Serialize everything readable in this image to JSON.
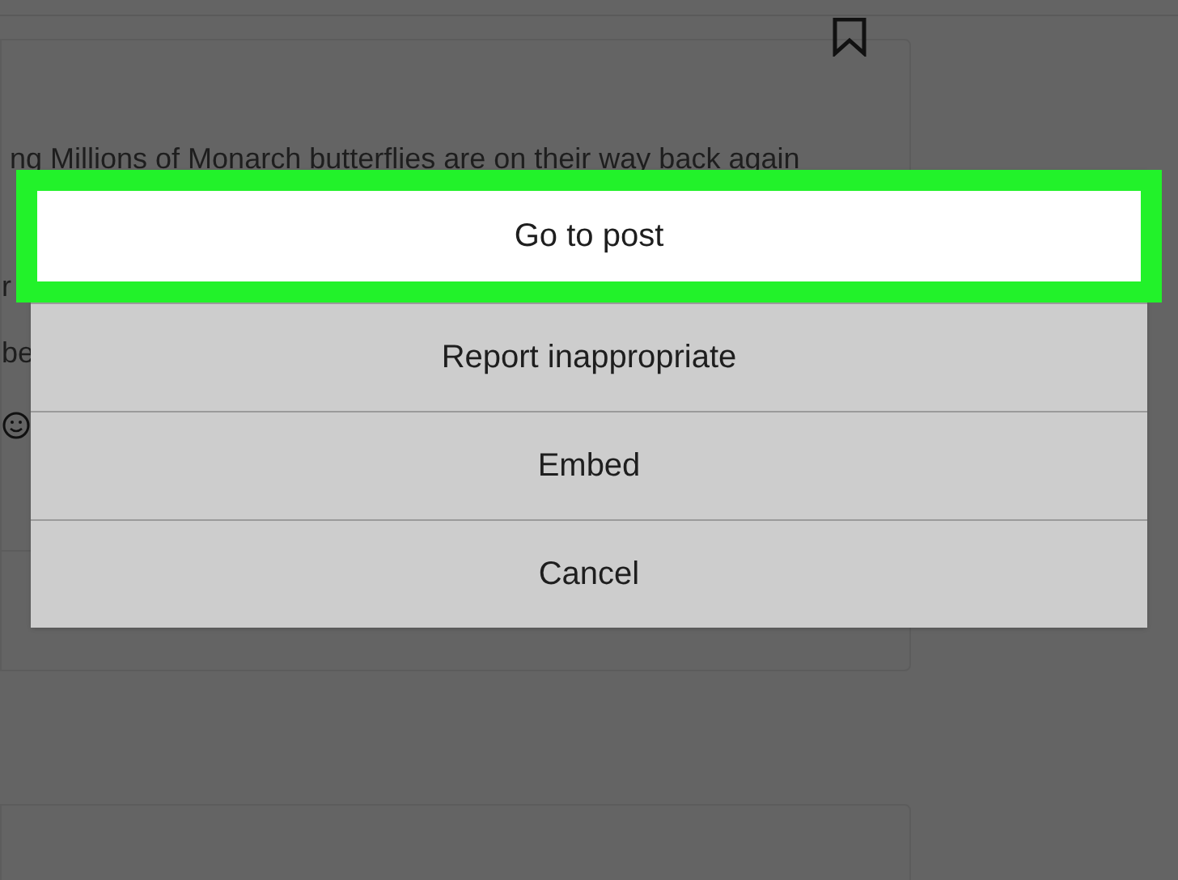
{
  "post": {
    "caption": "ng Millions of Monarch butterflies are on their way back again",
    "fragments": [
      "r",
      "be"
    ]
  },
  "menu": [
    {
      "label": "Go to post",
      "highlighted": true
    },
    {
      "label": "Report inappropriate",
      "highlighted": false
    },
    {
      "label": "Embed",
      "highlighted": false
    },
    {
      "label": "Cancel",
      "highlighted": false
    }
  ]
}
